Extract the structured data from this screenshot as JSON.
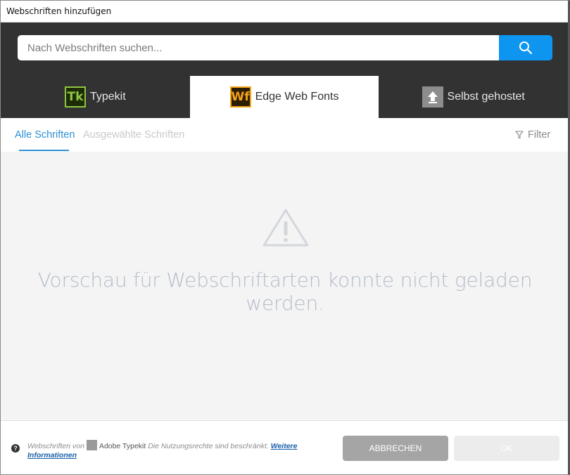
{
  "window": {
    "title": "Webschriften hinzufügen"
  },
  "search": {
    "placeholder": "Nach Webschriften suchen...",
    "button_icon": "search-icon"
  },
  "tabs": [
    {
      "badge": "Tk",
      "label": "Typekit",
      "icon": "typekit-icon"
    },
    {
      "badge": "Wf",
      "label": "Edge Web Fonts",
      "icon": "edge-web-fonts-icon",
      "active": true
    },
    {
      "badge": "",
      "label": "Selbst gehostet",
      "icon": "upload-icon"
    }
  ],
  "subtabs": {
    "all": "Alle Schriften",
    "selected": "Ausgewählte Schriften",
    "filter": "Filter"
  },
  "main": {
    "icon": "warning-icon",
    "message": "Vorschau für Webschriftarten konnte nicht geladen werden."
  },
  "footer": {
    "notice_prefix": "Webschriften von",
    "brand": "Adobe Typekit",
    "notice_suffix": "Die Nutzungsrechte sind beschränkt.",
    "link": "Weitere Informationen",
    "cancel_label": "ABBRECHEN",
    "ok_label": "OK"
  },
  "colors": {
    "accent": "#0d95f0",
    "header_bg": "#323232",
    "tab_link": "#2b8fd6",
    "typekit": "#8ec641",
    "edge": "#f3a316"
  }
}
